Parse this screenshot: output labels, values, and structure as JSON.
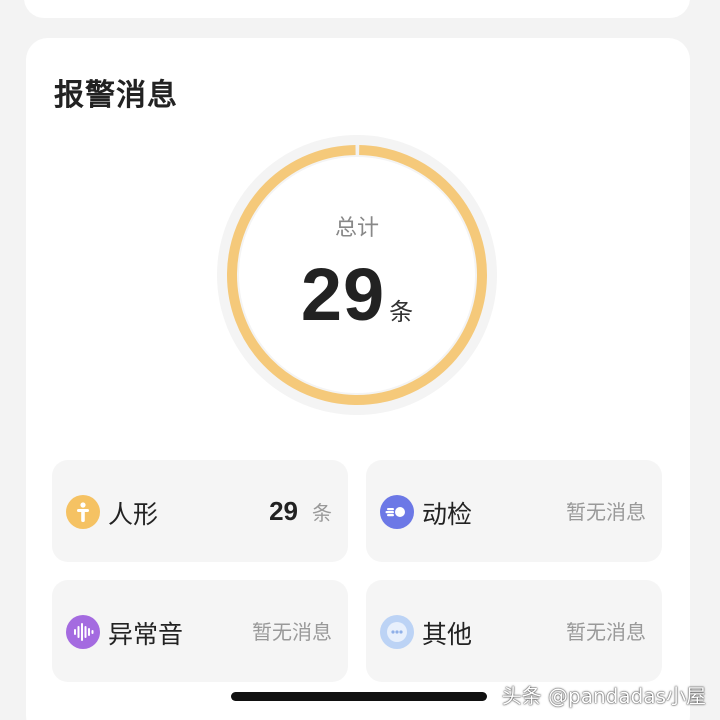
{
  "alarm": {
    "title": "报警消息",
    "total_label": "总计",
    "total_count": "29",
    "unit": "条",
    "ring_fraction": 1.0
  },
  "categories": [
    {
      "label": "人形",
      "count": "29",
      "unit": "条",
      "empty_text": "",
      "icon": "person-icon",
      "color": "#f5c263"
    },
    {
      "label": "动检",
      "count": "",
      "unit": "",
      "empty_text": "暂无消息",
      "icon": "motion-icon",
      "color": "#6c78e6"
    },
    {
      "label": "异常音",
      "count": "",
      "unit": "",
      "empty_text": "暂无消息",
      "icon": "sound-wave-icon",
      "color": "#a46be0"
    },
    {
      "label": "其他",
      "count": "",
      "unit": "",
      "empty_text": "暂无消息",
      "icon": "more-icon",
      "color": "#bcd3f5"
    }
  ],
  "colors": {
    "ring_fill": "#f5c97a",
    "ring_track": "#f2f2f2",
    "card_bg": "#ffffff",
    "tile_bg": "#f5f5f5"
  },
  "watermark": "头条 @pandadas小屋"
}
